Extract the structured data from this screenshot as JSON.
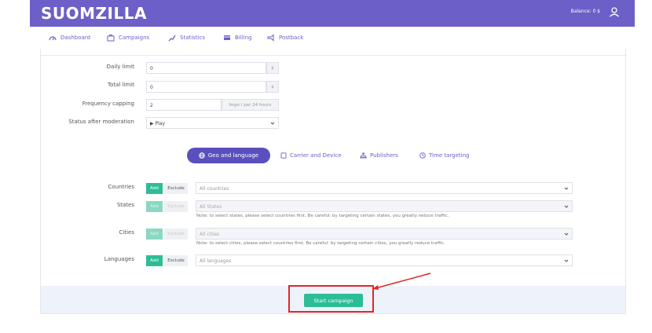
{
  "header": {
    "logo": "SUOMZILLA",
    "balance": "Balance: 0 $",
    "brand_color": "#6c5fc7"
  },
  "nav": {
    "items": [
      {
        "label": "Dashboard",
        "icon": "dashboard-icon"
      },
      {
        "label": "Campaigns",
        "icon": "briefcase-icon"
      },
      {
        "label": "Statistics",
        "icon": "chart-line-icon"
      },
      {
        "label": "Billing",
        "icon": "credit-card-icon"
      },
      {
        "label": "Postback",
        "icon": "megaphone-icon"
      }
    ]
  },
  "limits": {
    "daily_label": "Daily limit",
    "daily_value": "0",
    "daily_unit": "$",
    "total_label": "Total limit",
    "total_value": "0",
    "total_unit": "$",
    "frequency_label": "Frequency capping",
    "frequency_value": "2",
    "frequency_unit": "Imps / per 24 hours",
    "status_label": "Status after moderation",
    "status_value": "▶ Play"
  },
  "tabs": {
    "geo": "Geo and language",
    "carrier": "Carrier and Device",
    "publishers": "Publishers",
    "time": "Time targeting"
  },
  "targeting": {
    "add_label": "Add",
    "exclude_label": "Exclude",
    "countries_label": "Countries",
    "countries_placeholder": "All countries",
    "states_label": "States",
    "states_placeholder": "All States",
    "states_note": "Note: to select states, please select countries first. Be careful: by targeting certain states, you greatly reduce traffic.",
    "cities_label": "Cities",
    "cities_placeholder": "All cities",
    "cities_note": "Note: to select cities, please select countries first. Be careful: by targeting certain cities, you greatly reduce traffic.",
    "languages_label": "Languages",
    "languages_placeholder": "All languages"
  },
  "footer": {
    "start_label": "Start campaign",
    "accent_color": "#2dbd96",
    "highlight_color": "#e32626"
  }
}
